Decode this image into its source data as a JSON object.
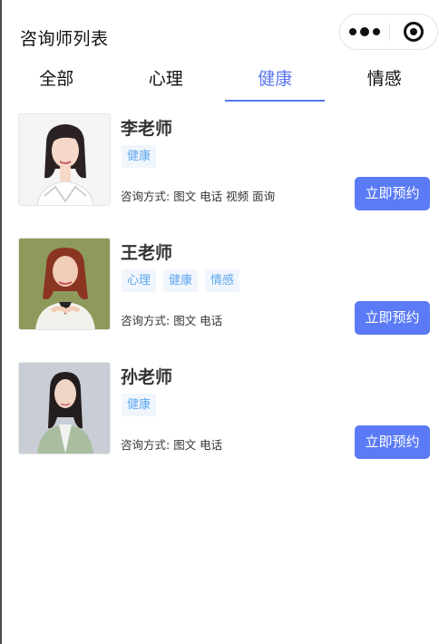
{
  "header": {
    "title": "咨询师列表"
  },
  "tabs": [
    {
      "label": "全部",
      "active": false
    },
    {
      "label": "心理",
      "active": false
    },
    {
      "label": "健康",
      "active": true
    },
    {
      "label": "情感",
      "active": false
    }
  ],
  "colors": {
    "accent": "#5a78f0",
    "button": "#5b7bf6",
    "tag_text": "#5ea7f2",
    "tag_bg": "#f1f6fc"
  },
  "counselors": [
    {
      "name": "李老师",
      "tags": [
        "健康"
      ],
      "method_label": "咨询方式:",
      "methods": "图文 电话 视频 面询",
      "button": "立即预约"
    },
    {
      "name": "王老师",
      "tags": [
        "心理",
        "健康",
        "情感"
      ],
      "method_label": "咨询方式:",
      "methods": "图文 电话",
      "button": "立即预约"
    },
    {
      "name": "孙老师",
      "tags": [
        "健康"
      ],
      "method_label": "咨询方式:",
      "methods": "图文 电话",
      "button": "立即预约"
    }
  ],
  "capsule": {
    "icons": [
      "more-dots-icon",
      "target-close-icon"
    ]
  }
}
